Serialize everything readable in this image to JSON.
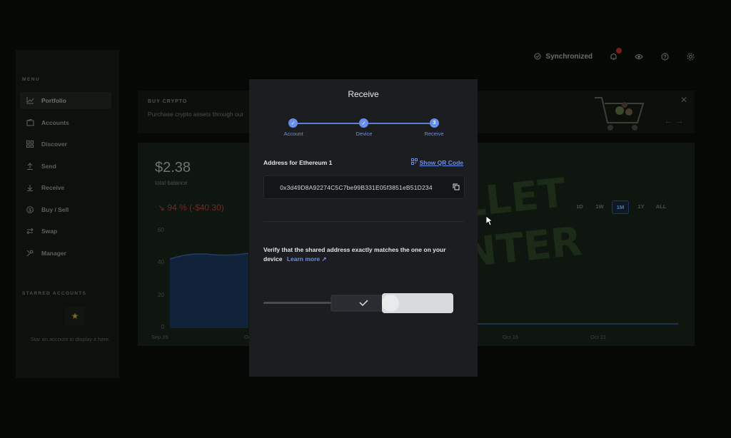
{
  "topbar": {
    "sync_label": "Synchronized",
    "notification_count": "1"
  },
  "sidebar": {
    "menu_title": "MENU",
    "items": [
      {
        "label": "Portfolio",
        "icon": "chart-icon"
      },
      {
        "label": "Accounts",
        "icon": "wallet-icon"
      },
      {
        "label": "Discover",
        "icon": "grid-icon"
      },
      {
        "label": "Send",
        "icon": "arrow-up-icon"
      },
      {
        "label": "Receive",
        "icon": "arrow-down-icon"
      },
      {
        "label": "Buy / Sell",
        "icon": "dollar-icon"
      },
      {
        "label": "Swap",
        "icon": "swap-icon"
      },
      {
        "label": "Manager",
        "icon": "tools-icon"
      }
    ],
    "starred_title": "STARRED ACCOUNTS",
    "starred_empty": "Star an account to display it here."
  },
  "banner": {
    "title": "BUY CRYPTO",
    "text": "Purchase crypto assets through our"
  },
  "portfolio": {
    "balance": "$2.38",
    "balance_label": "total balance",
    "change": "↘ 94 % (-$40.30)",
    "ranges": [
      "1D",
      "1W",
      "1M",
      "1Y",
      "ALL"
    ],
    "selected_range": "1M",
    "y_ticks": [
      "60",
      "40",
      "20",
      "0"
    ],
    "x_ticks": [
      "Sep 25",
      "Oct",
      "Oct 16",
      "Oct 21"
    ]
  },
  "modal": {
    "title": "Receive",
    "steps": [
      {
        "label": "Account",
        "marker": "✓"
      },
      {
        "label": "Device",
        "marker": "✓"
      },
      {
        "label": "Receive",
        "marker": "3"
      }
    ],
    "address_label": "Address for Ethereum 1",
    "qr_link": "Show QR Code",
    "address": "0x3d49D8A92274C5C7be99B331E05f3851eB51D234",
    "verify_text": "Verify that the shared address exactly matches the one on your device",
    "learn_more": "Learn more"
  },
  "colors": {
    "accent": "#6b8fe6",
    "negative": "#6b2b26",
    "modal_bg": "#1c1d21"
  }
}
